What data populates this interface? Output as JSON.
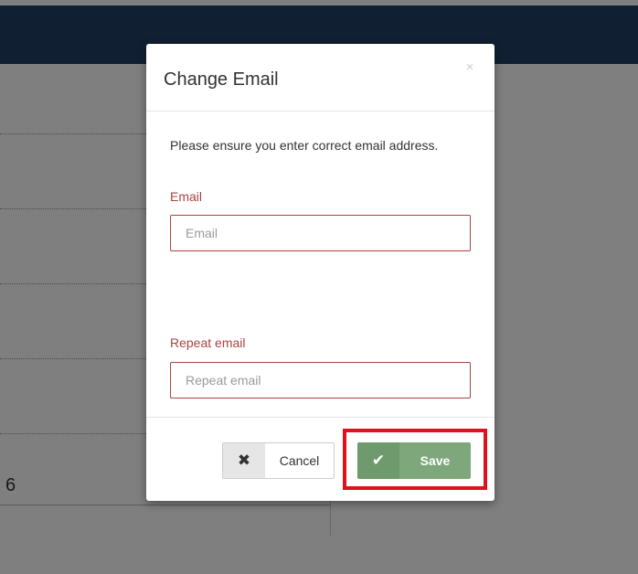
{
  "background": {
    "partial_value": "6"
  },
  "modal": {
    "title": "Change Email",
    "close_glyph": "×",
    "instruction": "Please ensure you enter correct email address.",
    "email": {
      "label": "Email",
      "value": "",
      "placeholder": "Email"
    },
    "repeat_email": {
      "label": "Repeat email",
      "value": "",
      "placeholder": "Repeat email"
    },
    "footer": {
      "cancel_icon": "✖",
      "cancel_label": "Cancel",
      "save_icon": "✔",
      "save_label": "Save"
    }
  },
  "colors": {
    "topbar": "#203e63",
    "error": "#a94442",
    "save_button": "#7ea77c",
    "highlight": "#e0101c"
  },
  "icons": {
    "close": "close-icon",
    "cancel": "times-icon",
    "save": "check-icon"
  }
}
